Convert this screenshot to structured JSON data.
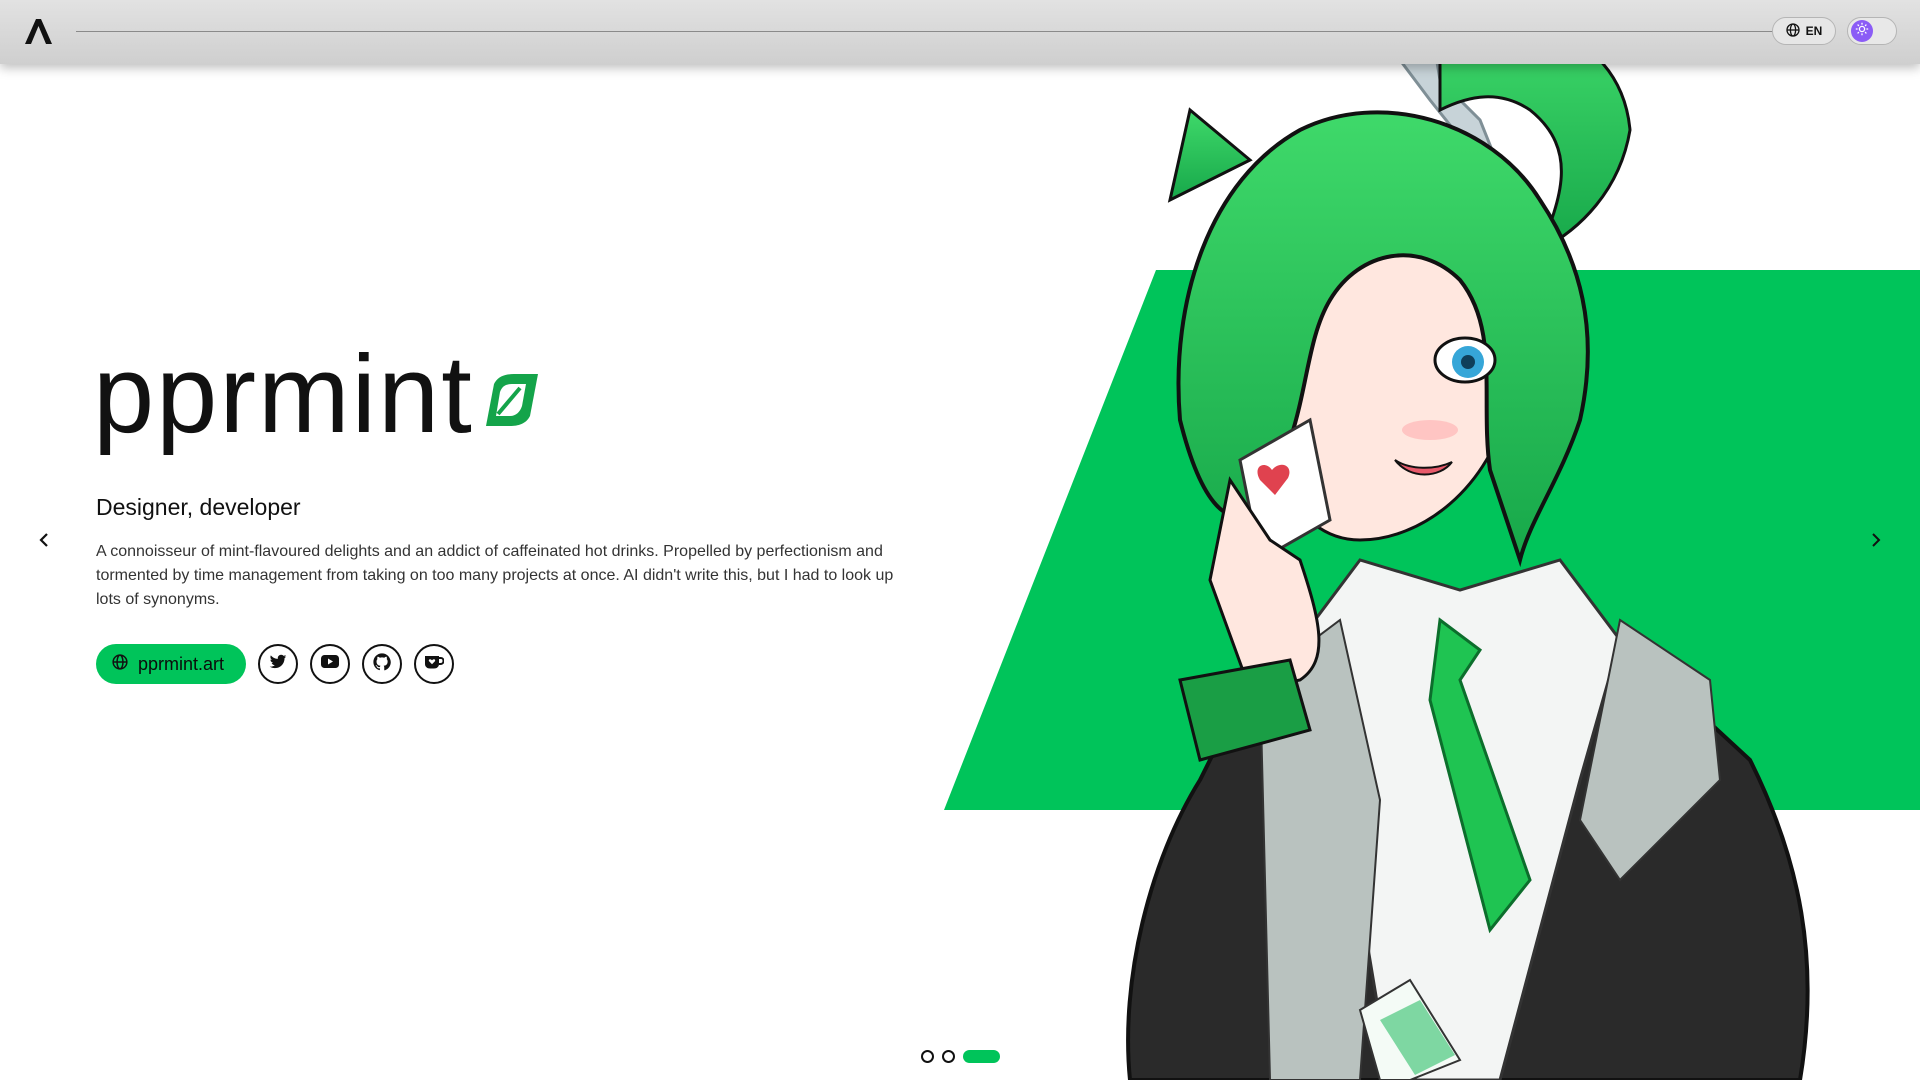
{
  "header": {
    "logo_icon": "app-logo-icon",
    "language_label": "EN",
    "language_icon": "globe-icon",
    "theme_icon": "sun-icon",
    "theme_accent": "#8b5cf6"
  },
  "hero": {
    "brand_name": "pprmint",
    "brand_mark_icon": "leaf-icon",
    "role": "Designer, developer",
    "bio": "A connoisseur of mint-flavoured delights and an addict of caffeinated hot drinks. Propelled by perfectionism and tormented by time management from taking on too many projects at once. AI didn't write this, but I had to look up lots of synonyms.",
    "website_label": "pprmint.art",
    "website_icon": "globe-icon",
    "social_icons": [
      "twitter-icon",
      "youtube-icon",
      "github-icon",
      "kofi-icon"
    ],
    "accent_color": "#00c45a"
  },
  "carousel": {
    "prev_icon": "chevron-left-icon",
    "next_icon": "chevron-right-icon",
    "slide_count": 3,
    "active_slide": 3
  }
}
